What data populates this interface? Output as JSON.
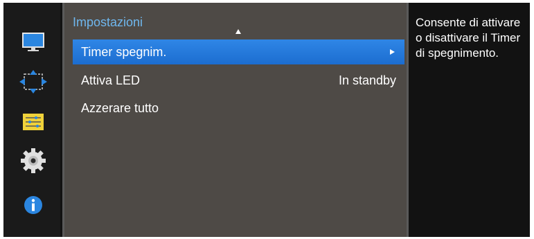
{
  "sidebar": {
    "items": [
      {
        "icon": "monitor-icon"
      },
      {
        "icon": "arrows-icon"
      },
      {
        "icon": "sliders-icon"
      },
      {
        "icon": "gear-icon"
      },
      {
        "icon": "info-icon"
      }
    ]
  },
  "menu": {
    "title": "Impostazioni",
    "items": [
      {
        "label": "Timer spegnim.",
        "value": "",
        "selected": true
      },
      {
        "label": "Attiva LED",
        "value": "In standby",
        "selected": false
      },
      {
        "label": "Azzerare tutto",
        "value": "",
        "selected": false
      }
    ]
  },
  "help": {
    "text": "Consente di attivare o disattivare il Timer di spegnimento."
  },
  "colors": {
    "accent": "#2f86e6",
    "title": "#6fb7ee",
    "panel_bg": "#4e4a46",
    "rail_bg": "#1a1a1a"
  }
}
